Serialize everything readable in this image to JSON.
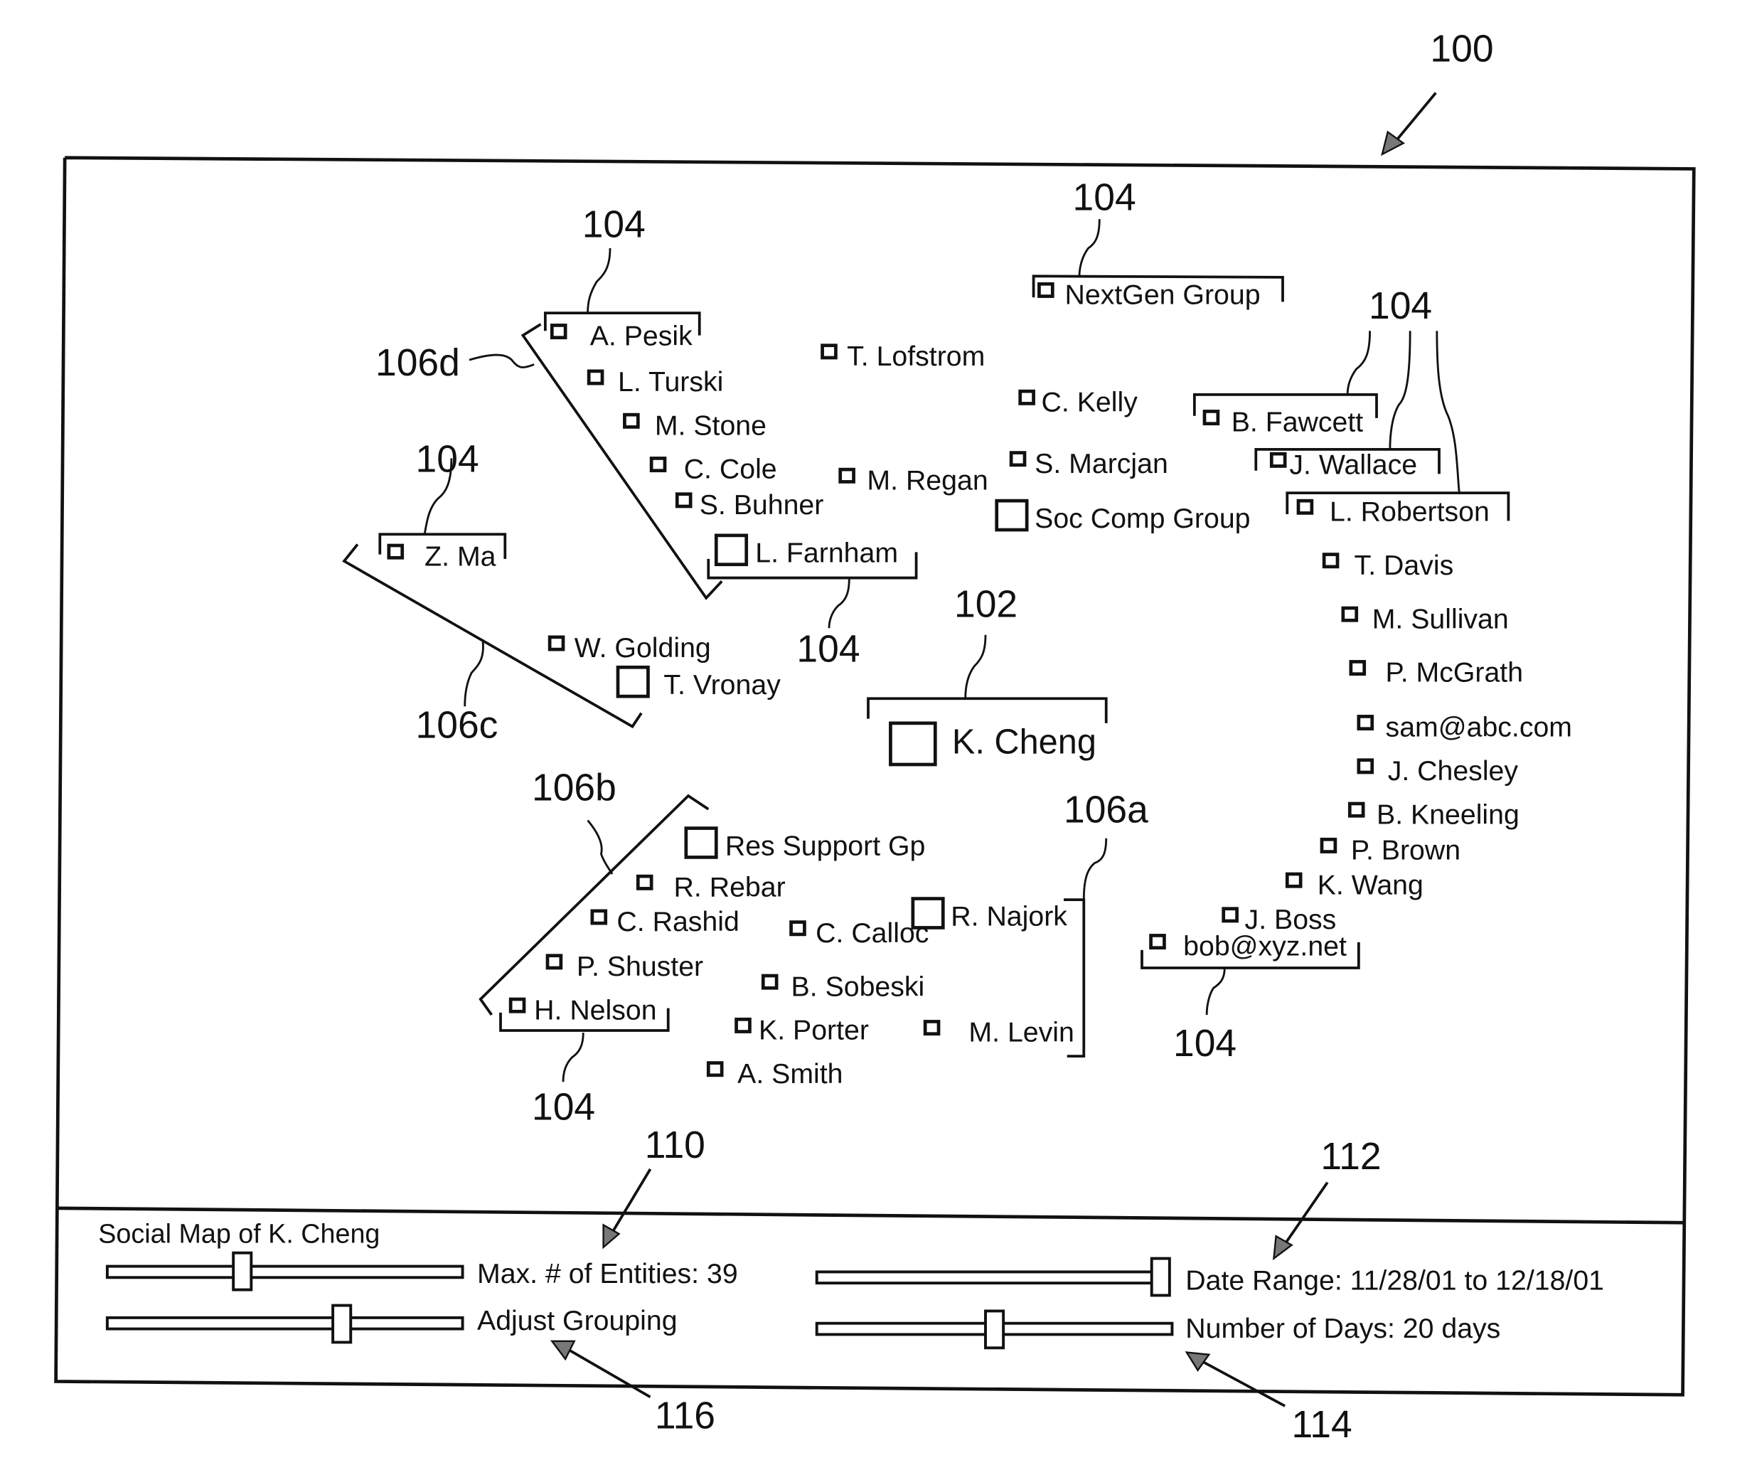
{
  "figure": {
    "reference_numerals": {
      "window": "100",
      "center_entity": "102",
      "entity_label": "104",
      "group_a": "106a",
      "group_b": "106b",
      "group_c": "106c",
      "group_d": "106d",
      "max_entities_control": "110",
      "date_range_control": "112",
      "days_control": "114",
      "grouping_control": "116"
    }
  },
  "map": {
    "center": {
      "label": "K. Cheng"
    },
    "entities": [
      {
        "id": "a-pesik",
        "label": "A. Pesik",
        "size": "small"
      },
      {
        "id": "l-turski",
        "label": "L. Turski",
        "size": "small"
      },
      {
        "id": "m-stone",
        "label": "M. Stone",
        "size": "small"
      },
      {
        "id": "c-cole",
        "label": "C. Cole",
        "size": "small"
      },
      {
        "id": "s-buhner",
        "label": "S. Buhner",
        "size": "small"
      },
      {
        "id": "l-farnham",
        "label": "L. Farnham",
        "size": "large"
      },
      {
        "id": "t-lofstrom",
        "label": "T. Lofstrom",
        "size": "small"
      },
      {
        "id": "m-regan",
        "label": "M. Regan",
        "size": "small"
      },
      {
        "id": "nextgen-group",
        "label": "NextGen Group",
        "size": "small"
      },
      {
        "id": "c-kelly",
        "label": "C. Kelly",
        "size": "small"
      },
      {
        "id": "s-marcjan",
        "label": "S. Marcjan",
        "size": "small"
      },
      {
        "id": "soc-comp-group",
        "label": "Soc Comp Group",
        "size": "large"
      },
      {
        "id": "b-fawcett",
        "label": "B. Fawcett",
        "size": "small"
      },
      {
        "id": "j-wallace",
        "label": "J. Wallace",
        "size": "small"
      },
      {
        "id": "l-robertson",
        "label": "L. Robertson",
        "size": "small"
      },
      {
        "id": "t-davis",
        "label": "T. Davis",
        "size": "small"
      },
      {
        "id": "m-sullivan",
        "label": "M. Sullivan",
        "size": "small"
      },
      {
        "id": "p-mcgrath",
        "label": "P. McGrath",
        "size": "small"
      },
      {
        "id": "sam-abc",
        "label": "sam@abc.com",
        "size": "small"
      },
      {
        "id": "j-chesley",
        "label": "J. Chesley",
        "size": "small"
      },
      {
        "id": "b-kneeling",
        "label": "B. Kneeling",
        "size": "small"
      },
      {
        "id": "p-brown",
        "label": "P. Brown",
        "size": "small"
      },
      {
        "id": "k-wang",
        "label": "K. Wang",
        "size": "small"
      },
      {
        "id": "j-boss",
        "label": "J. Boss",
        "size": "small"
      },
      {
        "id": "bob-xyz",
        "label": "bob@xyz.net",
        "size": "small"
      },
      {
        "id": "z-ma",
        "label": "Z. Ma",
        "size": "small"
      },
      {
        "id": "w-golding",
        "label": "W. Golding",
        "size": "small"
      },
      {
        "id": "t-vronay",
        "label": "T. Vronay",
        "size": "large"
      },
      {
        "id": "res-support-gp",
        "label": "Res Support Gp",
        "size": "large"
      },
      {
        "id": "r-rebar",
        "label": "R. Rebar",
        "size": "small"
      },
      {
        "id": "c-rashid",
        "label": "C. Rashid",
        "size": "small"
      },
      {
        "id": "c-calloc",
        "label": "C. Calloc",
        "size": "small"
      },
      {
        "id": "r-najork",
        "label": "R. Najork",
        "size": "large"
      },
      {
        "id": "p-shuster",
        "label": "P. Shuster",
        "size": "small"
      },
      {
        "id": "b-sobeski",
        "label": "B. Sobeski",
        "size": "small"
      },
      {
        "id": "h-nelson",
        "label": "H. Nelson",
        "size": "small"
      },
      {
        "id": "k-porter",
        "label": "K. Porter",
        "size": "small"
      },
      {
        "id": "m-levin",
        "label": "M. Levin",
        "size": "small"
      },
      {
        "id": "a-smith",
        "label": "A. Smith",
        "size": "small"
      }
    ]
  },
  "controls": {
    "title": "Social Map of K. Cheng",
    "max_entities": {
      "label": "Max. # of Entities: 39",
      "value": 39,
      "fraction": 0.38
    },
    "grouping": {
      "label": "Adjust Grouping",
      "fraction": 0.66
    },
    "date_range": {
      "label": "Date Range:  11/28/01 to 12/18/01",
      "from": "11/28/01",
      "to": "12/18/01",
      "fraction": 0.98
    },
    "days": {
      "label": "Number of Days: 20 days",
      "value": 20,
      "fraction": 0.5
    }
  }
}
